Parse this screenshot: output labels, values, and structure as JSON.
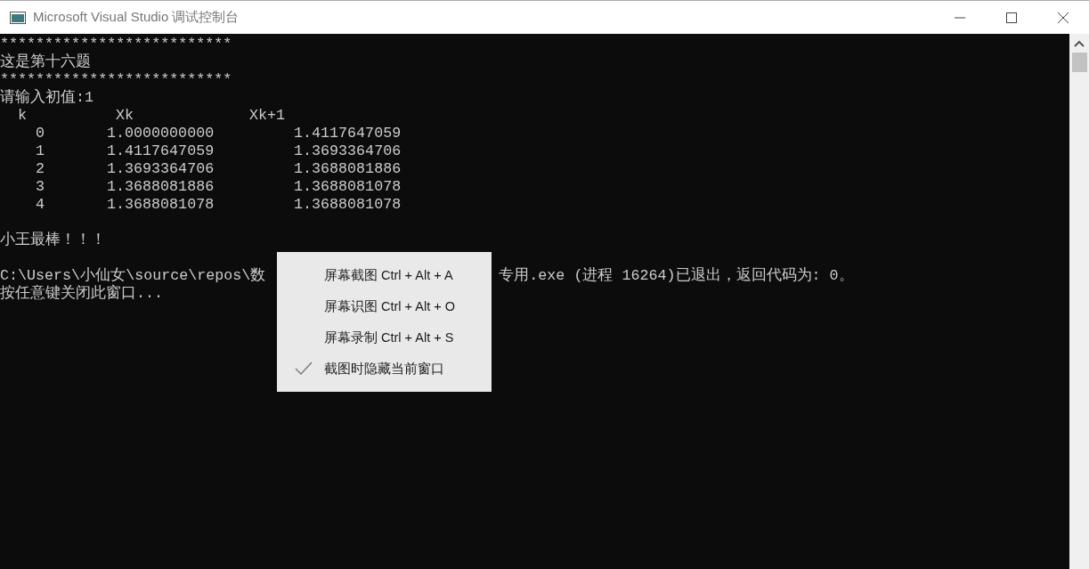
{
  "window": {
    "title": "Microsoft Visual Studio 调试控制台"
  },
  "console": {
    "lines_before": [
      "**************************",
      "这是第十六题",
      "**************************",
      "请输入初值:1"
    ],
    "table": {
      "columns": [
        "k",
        "Xk",
        "Xk+1"
      ],
      "rows": [
        {
          "cells": [
            "0",
            "1.0000000000",
            "1.4117647059"
          ]
        },
        {
          "cells": [
            "1",
            "1.4117647059",
            "1.3693364706"
          ]
        },
        {
          "cells": [
            "2",
            "1.3693364706",
            "1.3688081886"
          ]
        },
        {
          "cells": [
            "3",
            "1.3688081886",
            "1.3688081078"
          ]
        },
        {
          "cells": [
            "4",
            "1.3688081078",
            "1.3688081078"
          ]
        }
      ]
    },
    "message": "小王最棒！！！",
    "exit_line_start": "C:\\Users\\小仙女\\source\\repos\\数",
    "exit_line_end": "专用.exe (进程 16264)已退出，返回代码为: 0。",
    "close_prompt": "按任意键关闭此窗口..."
  },
  "context_menu": {
    "items": [
      {
        "label": "屏幕截图 Ctrl + Alt + A",
        "checked": false
      },
      {
        "label": "屏幕识图 Ctrl + Alt + O",
        "checked": false
      },
      {
        "label": "屏幕录制 Ctrl + Alt + S",
        "checked": false
      },
      {
        "label": "截图时隐藏当前窗口",
        "checked": true
      }
    ]
  }
}
